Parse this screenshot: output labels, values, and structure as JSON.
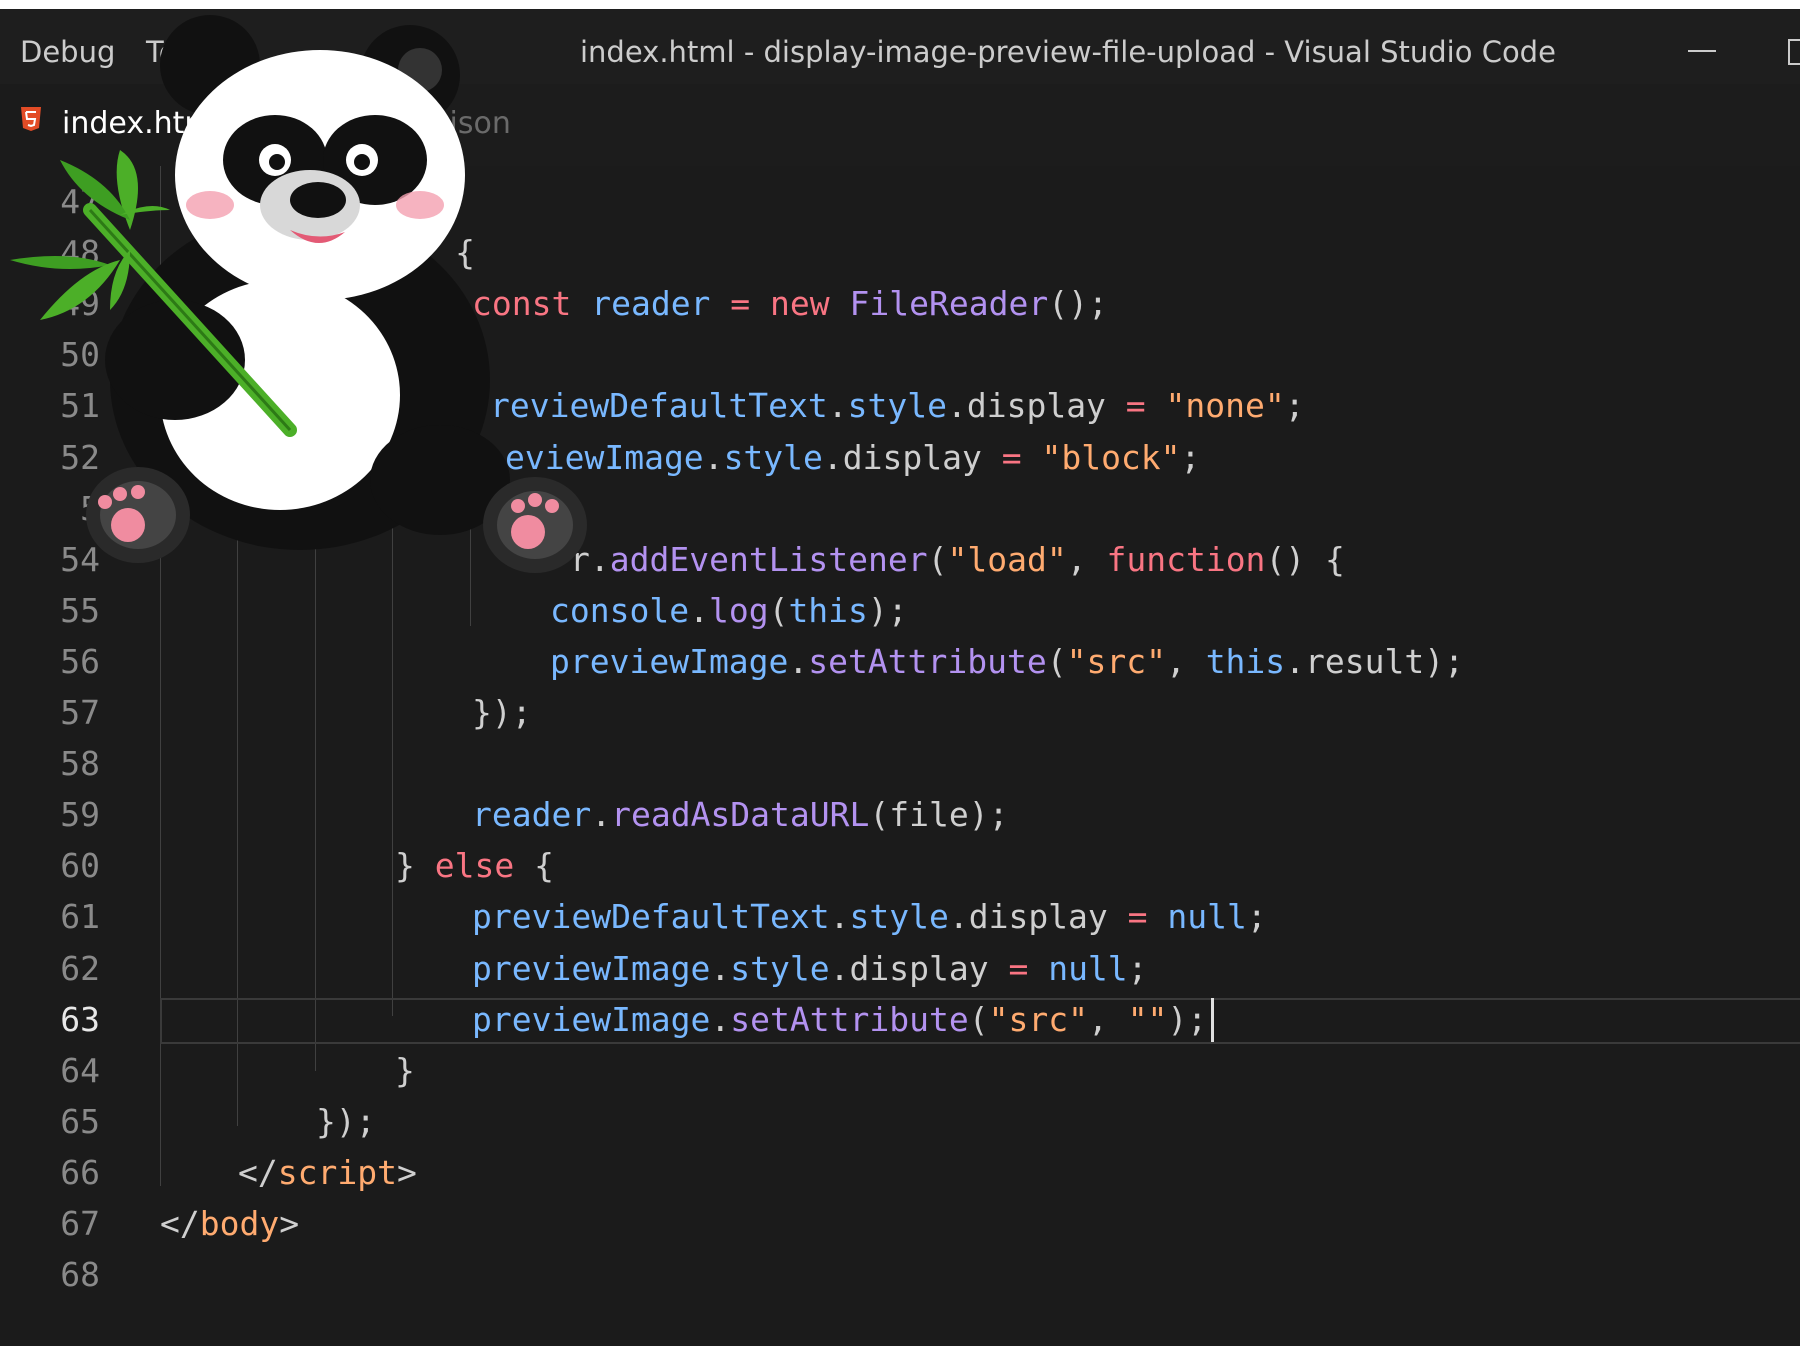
{
  "titlebar": {
    "menu": [
      "Debug",
      "Te"
    ],
    "title": "index.html - display-image-preview-file-upload - Visual Studio Code"
  },
  "tabs": [
    {
      "label": "index.html",
      "icon": "html5-icon",
      "active": true
    },
    {
      "label": ".json",
      "active": false
    }
  ],
  "editor": {
    "active_line": "63",
    "gutter": [
      "47",
      "48",
      "49",
      "50",
      "51",
      "52",
      "5",
      "54",
      "55",
      "56",
      "57",
      "58",
      "59",
      "60",
      "61",
      "62",
      "63",
      "64",
      "65",
      "66",
      "67",
      "68"
    ],
    "lines": [
      [],
      [
        {
          "t": "p",
          "v": "(file) {"
        }
      ],
      [
        {
          "t": "kw",
          "v": "const "
        },
        {
          "t": "var",
          "v": "reader"
        },
        {
          "t": "kw",
          "v": " = "
        },
        {
          "t": "kw",
          "v": "new "
        },
        {
          "t": "fn",
          "v": "FileReader"
        },
        {
          "t": "p",
          "v": "();"
        }
      ],
      [],
      [
        {
          "t": "var",
          "v": "reviewDefaultText"
        },
        {
          "t": "p",
          "v": "."
        },
        {
          "t": "var",
          "v": "style"
        },
        {
          "t": "p",
          "v": ".display "
        },
        {
          "t": "kw",
          "v": "="
        },
        {
          "t": "str",
          "v": " \"none\""
        },
        {
          "t": "p",
          "v": ";"
        }
      ],
      [
        {
          "t": "var",
          "v": "eviewImage"
        },
        {
          "t": "p",
          "v": "."
        },
        {
          "t": "var",
          "v": "style"
        },
        {
          "t": "p",
          "v": ".display "
        },
        {
          "t": "kw",
          "v": "="
        },
        {
          "t": "str",
          "v": " \"block\""
        },
        {
          "t": "p",
          "v": ";"
        }
      ],
      [],
      [
        {
          "t": "p",
          "v": "r."
        },
        {
          "t": "fn",
          "v": "addEventListener"
        },
        {
          "t": "p",
          "v": "("
        },
        {
          "t": "str",
          "v": "\"load\""
        },
        {
          "t": "p",
          "v": ", "
        },
        {
          "t": "kw",
          "v": "function"
        },
        {
          "t": "p",
          "v": "() {"
        }
      ],
      [
        {
          "t": "var",
          "v": "console"
        },
        {
          "t": "p",
          "v": "."
        },
        {
          "t": "fn",
          "v": "log"
        },
        {
          "t": "p",
          "v": "("
        },
        {
          "t": "this",
          "v": "this"
        },
        {
          "t": "p",
          "v": ");"
        }
      ],
      [
        {
          "t": "var",
          "v": "previewImage"
        },
        {
          "t": "p",
          "v": "."
        },
        {
          "t": "fn",
          "v": "setAttribute"
        },
        {
          "t": "p",
          "v": "("
        },
        {
          "t": "str",
          "v": "\"src\""
        },
        {
          "t": "p",
          "v": ", "
        },
        {
          "t": "this",
          "v": "this"
        },
        {
          "t": "p",
          "v": ".result);"
        }
      ],
      [
        {
          "t": "p",
          "v": "});"
        }
      ],
      [],
      [
        {
          "t": "var",
          "v": "reader"
        },
        {
          "t": "p",
          "v": "."
        },
        {
          "t": "fn",
          "v": "readAsDataURL"
        },
        {
          "t": "p",
          "v": "(file);"
        }
      ],
      [
        {
          "t": "p",
          "v": "} "
        },
        {
          "t": "kw",
          "v": "else"
        },
        {
          "t": "p",
          "v": " {"
        }
      ],
      [
        {
          "t": "var",
          "v": "previewDefaultText"
        },
        {
          "t": "p",
          "v": "."
        },
        {
          "t": "var",
          "v": "style"
        },
        {
          "t": "p",
          "v": ".display "
        },
        {
          "t": "kw",
          "v": "="
        },
        {
          "t": "var",
          "v": " null"
        },
        {
          "t": "p",
          "v": ";"
        }
      ],
      [
        {
          "t": "var",
          "v": "previewImage"
        },
        {
          "t": "p",
          "v": "."
        },
        {
          "t": "var",
          "v": "style"
        },
        {
          "t": "p",
          "v": ".display "
        },
        {
          "t": "kw",
          "v": "="
        },
        {
          "t": "var",
          "v": " null"
        },
        {
          "t": "p",
          "v": ";"
        }
      ],
      [
        {
          "t": "var",
          "v": "previewImage"
        },
        {
          "t": "p",
          "v": "."
        },
        {
          "t": "fn",
          "v": "setAttribute"
        },
        {
          "t": "p",
          "v": "("
        },
        {
          "t": "str",
          "v": "\"src\""
        },
        {
          "t": "p",
          "v": ", "
        },
        {
          "t": "str",
          "v": "\"\""
        },
        {
          "t": "p",
          "v": ");"
        }
      ],
      [
        {
          "t": "p",
          "v": "}"
        }
      ],
      [
        {
          "t": "p",
          "v": "});"
        }
      ],
      [
        {
          "t": "p",
          "v": "</"
        },
        {
          "t": "tag",
          "v": "script"
        },
        {
          "t": "p",
          "v": ">"
        }
      ],
      [
        {
          "t": "p",
          "v": "</"
        },
        {
          "t": "tag",
          "v": "body"
        },
        {
          "t": "p",
          "v": ">"
        }
      ],
      []
    ]
  },
  "colors": {
    "keyword": "#f97583",
    "variable": "#79b8ff",
    "function": "#b392f0",
    "string": "#ffab70",
    "background": "#1b1b1b"
  }
}
